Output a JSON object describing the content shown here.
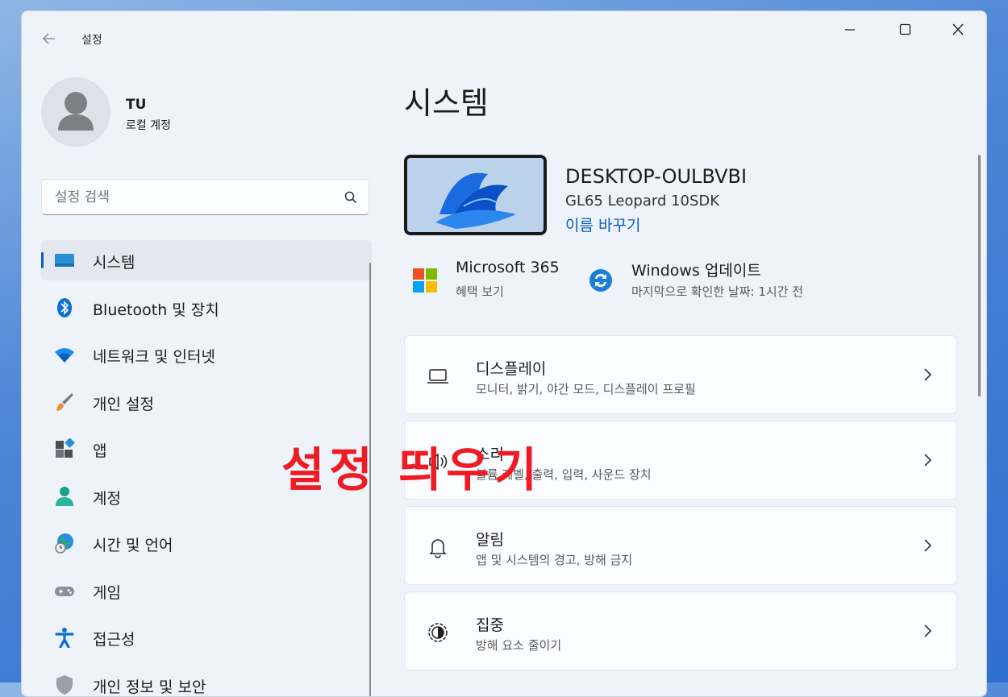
{
  "window": {
    "title": "설정"
  },
  "user": {
    "name": "TU",
    "account_type": "로컬 계정"
  },
  "search": {
    "placeholder": "설정 검색",
    "icon": "search-icon"
  },
  "nav": {
    "items": [
      {
        "label": "시스템",
        "icon": "system-icon",
        "active": true
      },
      {
        "label": "Bluetooth 및 장치",
        "icon": "bluetooth-icon"
      },
      {
        "label": "네트워크 및 인터넷",
        "icon": "wifi-icon"
      },
      {
        "label": "개인 설정",
        "icon": "brush-icon"
      },
      {
        "label": "앱",
        "icon": "apps-icon"
      },
      {
        "label": "계정",
        "icon": "account-icon"
      },
      {
        "label": "시간 및 언어",
        "icon": "globe-clock-icon"
      },
      {
        "label": "게임",
        "icon": "gamepad-icon"
      },
      {
        "label": "접근성",
        "icon": "accessibility-icon"
      },
      {
        "label": "개인 정보 및 보안",
        "icon": "shield-icon"
      }
    ]
  },
  "main": {
    "page_title": "시스템",
    "device": {
      "name": "DESKTOP-OULBVBI",
      "model": "GL65 Leopard 10SDK",
      "rename_link": "이름 바꾸기"
    },
    "quick": [
      {
        "title": "Microsoft 365",
        "subtitle": "혜택 보기",
        "icon": "microsoft-logo-icon"
      },
      {
        "title": "Windows 업데이트",
        "subtitle": "마지막으로 확인한 날짜: 1시간 전",
        "icon": "windows-update-icon"
      }
    ],
    "cards": [
      {
        "title": "디스플레이",
        "subtitle": "모니터, 밝기, 야간 모드, 디스플레이 프로필",
        "icon": "display-icon"
      },
      {
        "title": "소리",
        "subtitle": "볼륨 레벨, 출력, 입력, 사운드 장치",
        "icon": "sound-icon"
      },
      {
        "title": "알림",
        "subtitle": "앱 및 시스템의 경고, 방해 금지",
        "icon": "bell-icon"
      },
      {
        "title": "집중",
        "subtitle": "방해 요소 줄이기",
        "icon": "focus-icon"
      }
    ]
  },
  "overlay": {
    "caption": "설정 띄우기",
    "color": "#ee1b24"
  },
  "colors": {
    "accent": "#0a5fc4",
    "window_bg": "#eef2f9"
  }
}
